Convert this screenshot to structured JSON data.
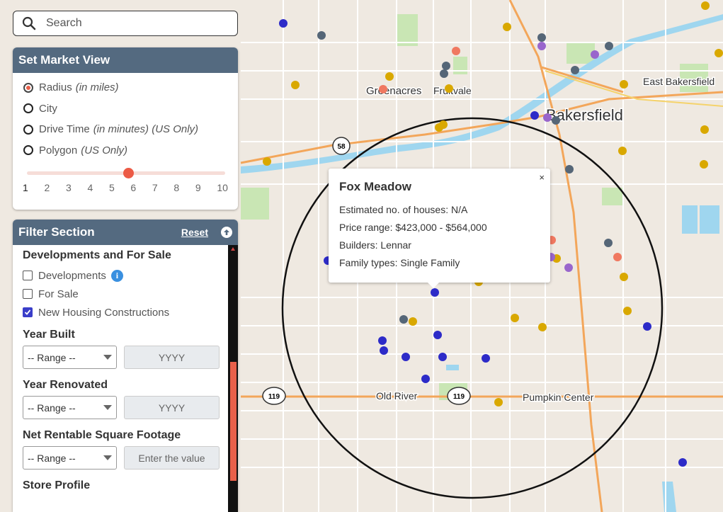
{
  "search": {
    "placeholder": "Search"
  },
  "market_view": {
    "title": "Set Market View",
    "options": [
      {
        "label": "Radius",
        "note": "(in miles)",
        "selected": true
      },
      {
        "label": "City",
        "note": "",
        "selected": false
      },
      {
        "label": "Drive Time",
        "note": "(in minutes) (US Only)",
        "selected": false
      },
      {
        "label": "Polygon",
        "note": "(US Only)",
        "selected": false
      }
    ],
    "slider_value": 5,
    "slider_ticks": [
      "1",
      "2",
      "3",
      "4",
      "5",
      "6",
      "7",
      "8",
      "9",
      "10"
    ]
  },
  "filter": {
    "title": "Filter Section",
    "reset_label": "Reset",
    "developments_title": "Developments and For Sale",
    "checkboxes": [
      {
        "label": "Developments",
        "checked": false
      },
      {
        "label": "For Sale",
        "checked": false
      },
      {
        "label": "New Housing Constructions",
        "checked": true
      }
    ],
    "year_built": {
      "title": "Year Built",
      "select": "-- Range --",
      "input_placeholder": "YYYY"
    },
    "year_renovated": {
      "title": "Year Renovated",
      "select": "-- Range --",
      "input_placeholder": "YYYY"
    },
    "net_rentable": {
      "title": "Net Rentable Square Footage",
      "select": "-- Range --",
      "input_placeholder": "Enter the value"
    },
    "store_profile": {
      "title": "Store Profile"
    }
  },
  "popup": {
    "title": "Fox Meadow",
    "close_label": "×",
    "lines": [
      "Estimated no. of houses: N/A",
      "Price range: $423,000 - $564,000",
      "Builders: Lennar",
      "Family types: Single Family"
    ]
  },
  "map": {
    "places": [
      "Greenacres",
      "Fruitvale",
      "East Bakersfield",
      "Bakersfield",
      "Old River",
      "Pumpkin Center"
    ],
    "route_shields": [
      "58",
      "119",
      "119"
    ],
    "marker_colors": {
      "blue": "#2d2bc8",
      "gray": "#556677",
      "yellow": "#d9a800",
      "orange": "#f07860",
      "purple": "#9966cc"
    }
  }
}
